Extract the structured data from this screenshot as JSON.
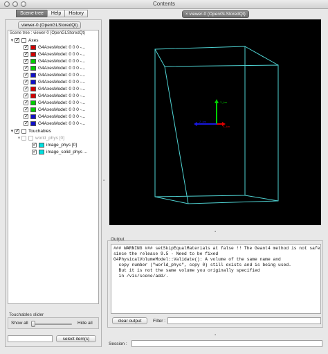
{
  "window": {
    "title": "Contents"
  },
  "tabs": [
    {
      "label": "Scene tree",
      "active": true
    },
    {
      "label": "Help",
      "active": false
    },
    {
      "label": "History",
      "active": false
    }
  ],
  "left": {
    "viewer_chip": "viewer-0 (OpenGLStoredQt)",
    "scene_tree_title": "Scene tree : viewer-0 (OpenGLStoredQt)",
    "tree": {
      "axes": {
        "label": "Axes",
        "children": [
          {
            "label": "G4AxesModel: 0 0 0 -...",
            "color": "#d00000"
          },
          {
            "label": "G4AxesModel: 0 0 0 -...",
            "color": "#d00000"
          },
          {
            "label": "G4AxesModel: 0 0 0 -...",
            "color": "#00cc00"
          },
          {
            "label": "G4AxesModel: 0 0 0 -...",
            "color": "#00cc00"
          },
          {
            "label": "G4AxesModel: 0 0 0 -...",
            "color": "#1010c8"
          },
          {
            "label": "G4AxesModel: 0 0 0 -...",
            "color": "#1010c8"
          },
          {
            "label": "G4AxesModel: 0 0 0 -...",
            "color": "#d00000"
          },
          {
            "label": "G4AxesModel: 0 0 0 -...",
            "color": "#d00000"
          },
          {
            "label": "G4AxesModel: 0 0 0 -...",
            "color": "#00cc00"
          },
          {
            "label": "G4AxesModel: 0 0 0 -...",
            "color": "#00cc00"
          },
          {
            "label": "G4AxesModel: 0 0 0 -...",
            "color": "#1010c8"
          },
          {
            "label": "G4AxesModel: 0 0 0 -...",
            "color": "#1010c8"
          }
        ]
      },
      "touchables": {
        "label": "Touchables",
        "world": "world_phys [0]",
        "children": [
          {
            "label": "image_phys [0]",
            "color": "#00e0e0"
          },
          {
            "label": "image_solid_phys ...",
            "color": "#00e0e0"
          }
        ]
      }
    },
    "slider_title": "Touchables slider",
    "show_all": "Show all",
    "hide_all": "Hide all",
    "slider_value": 0,
    "select_items": "select item(s)"
  },
  "viewer": {
    "tab_label": "viewer-0 (OpenGLStoredQt)",
    "box_color": "#4fd3d3",
    "axis_labels": {
      "x": "X_km",
      "y": "Y_km",
      "z": "Z_km"
    }
  },
  "output": {
    "title": "Output",
    "text": "### WARNING ### setSkipEqualMaterials at false !! The Geant4 method is not safe\nsince the release 9.5 - Need to be fixed\nG4PhysicalVolumeModel::Validate(): A volume of the same name and\n  copy number (\"world_phys\", copy 0) still exists and is being used.\n  But it is not the same volume you originally specified\n  in /vis/scene/add/.",
    "clear_button": "clear output",
    "filter_label": "Filter :",
    "session_label": "Session :"
  }
}
